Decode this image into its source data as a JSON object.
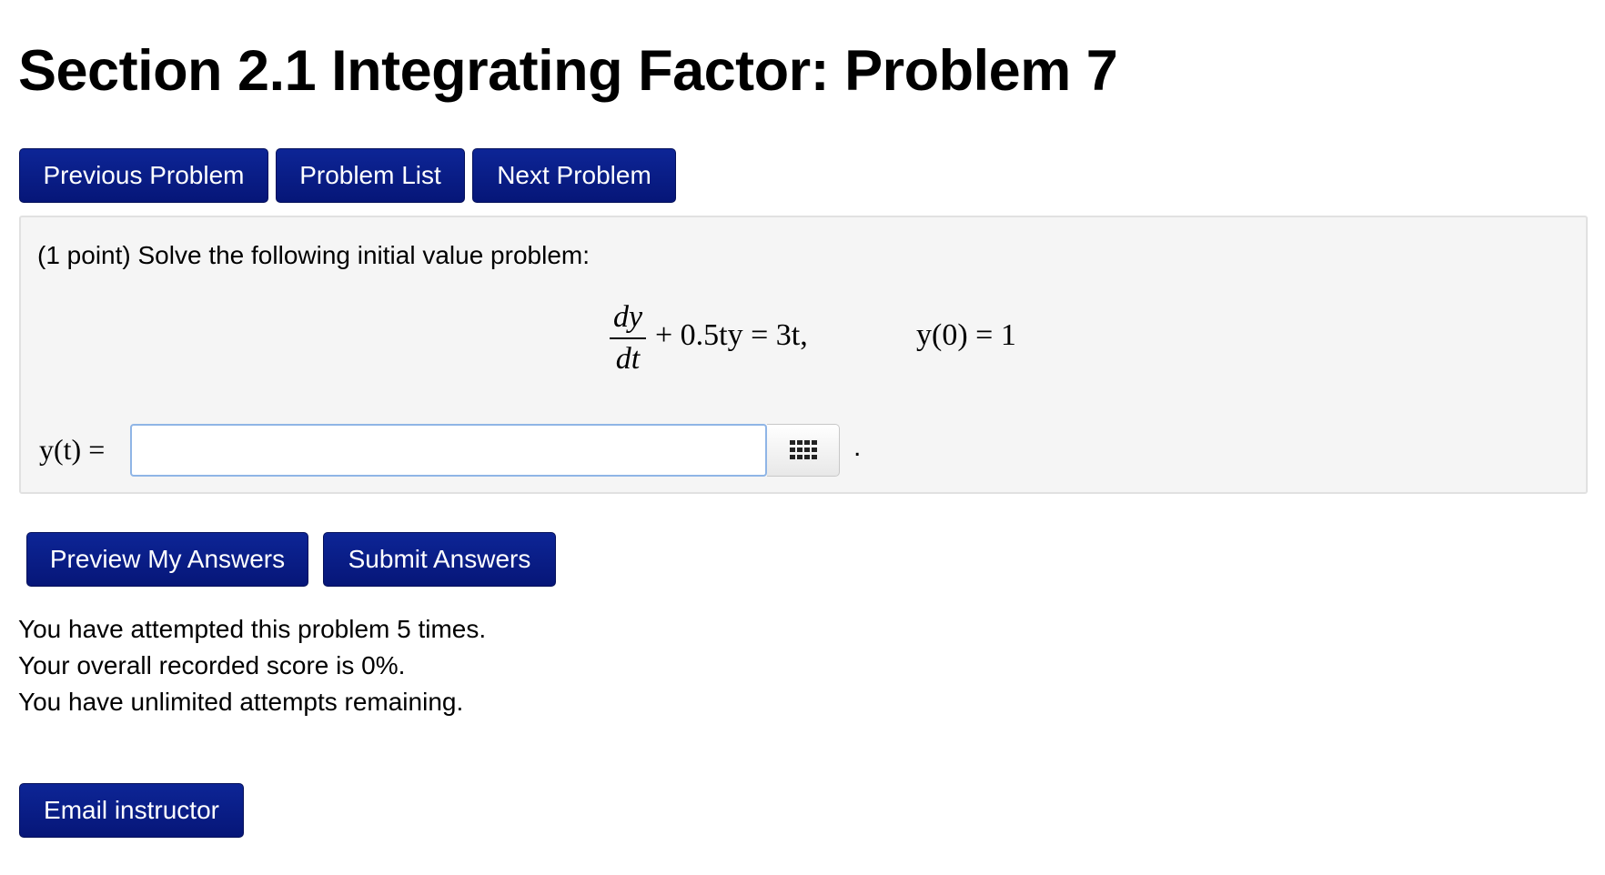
{
  "header": {
    "title": "Section 2.1 Integrating Factor: Problem 7"
  },
  "nav": {
    "previous": "Previous Problem",
    "list": "Problem List",
    "next": "Next Problem"
  },
  "problem": {
    "intro": "(1 point) Solve the following initial value problem:",
    "equation": {
      "numerator": "dy",
      "denominator": "dt",
      "rest": "+ 0.5ty = 3t,",
      "condition": "y(0) = 1"
    },
    "answer_label": "y(t) =",
    "answer_value": "",
    "answer_placeholder": "",
    "palette_icon": "equation-palette-grid-icon",
    "trailing_period": "."
  },
  "actions": {
    "preview": "Preview My Answers",
    "submit": "Submit Answers"
  },
  "status": {
    "attempts": "You have attempted this problem 5 times.",
    "score": "Your overall recorded score is 0%.",
    "remaining": "You have unlimited attempts remaining."
  },
  "footer": {
    "email": "Email instructor"
  },
  "colors": {
    "button_bg": "#0b1f8a",
    "button_text": "#ffffff",
    "problem_bg": "#f5f5f5",
    "input_border": "#8fb5e6"
  }
}
